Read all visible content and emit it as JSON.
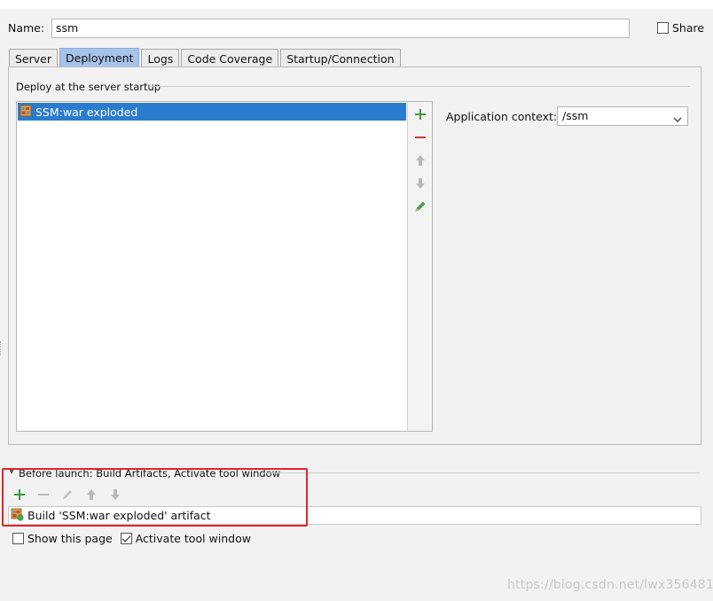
{
  "name_field": {
    "label": "Name:",
    "value": "ssm"
  },
  "share": {
    "label": "Share",
    "checked": false
  },
  "tabs": [
    {
      "label": "Server",
      "active": false
    },
    {
      "label": "Deployment",
      "active": true
    },
    {
      "label": "Logs",
      "active": false
    },
    {
      "label": "Code Coverage",
      "active": false
    },
    {
      "label": "Startup/Connection",
      "active": false
    }
  ],
  "deploy": {
    "title": "Deploy at the server startup",
    "items": [
      {
        "label": "SSM:war exploded",
        "selected": true
      }
    ],
    "toolbar": [
      "add-icon",
      "remove-icon",
      "move-up-icon",
      "move-down-icon",
      "edit-icon"
    ]
  },
  "application_context": {
    "label": "Application context:",
    "value": "/ssm"
  },
  "before_launch": {
    "title": "Before launch: Build Artifacts, Activate tool window",
    "toolbar": [
      "add-icon",
      "remove-icon",
      "edit-icon",
      "move-up-icon",
      "move-down-icon"
    ],
    "items": [
      {
        "label": "Build 'SSM:war exploded' artifact"
      }
    ]
  },
  "options": {
    "show_this_page": {
      "label": "Show this page",
      "checked": false
    },
    "activate_tool_window": {
      "label": "Activate tool window",
      "checked": true
    }
  },
  "watermark": "https://blog.csdn.net/lwx356481",
  "colors": {
    "selection": "#2b7bcf",
    "active_tab": "#a6c4ea",
    "add_green": "#3a9c3a",
    "remove_red": "#cc3b3b",
    "highlight_box": "#e5232a"
  }
}
